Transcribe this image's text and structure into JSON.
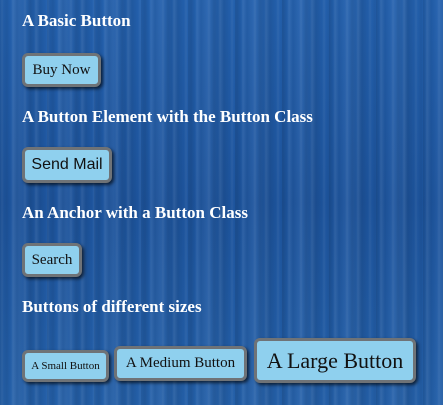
{
  "sections": [
    {
      "heading": "A Basic Button"
    },
    {
      "heading": "A Button Element with the Button Class"
    },
    {
      "heading": "An Anchor with a Button Class"
    },
    {
      "heading": "Buttons of different sizes"
    }
  ],
  "buttons": {
    "buy_now": "Buy Now",
    "send_mail": "Send Mail",
    "search": "Search",
    "small": "A Small Button",
    "medium": "A Medium Button",
    "large": "A Large Button"
  },
  "colors": {
    "background": "#1f58a3",
    "button_fill": "#8fd0ee",
    "button_border": "#6f7377",
    "heading_text": "#ffffff"
  }
}
